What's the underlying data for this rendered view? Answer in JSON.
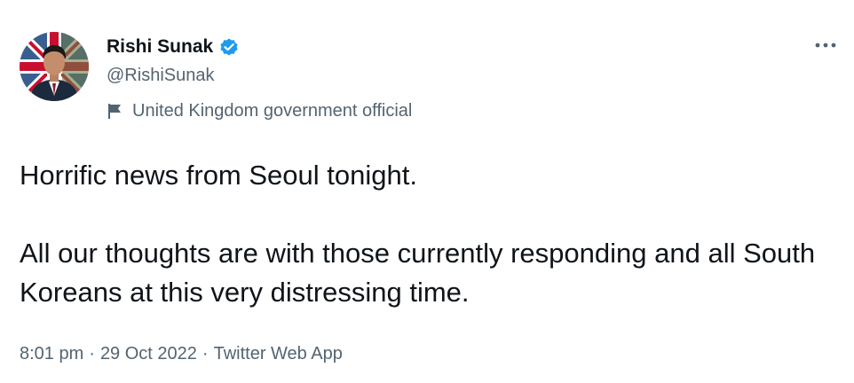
{
  "author": {
    "display_name": "Rishi Sunak",
    "handle": "@RishiSunak",
    "verified": true,
    "label": "United Kingdom government official"
  },
  "tweet": {
    "paragraphs": [
      "Horrific news from Seoul tonight.",
      "All our thoughts are with those currently responding and all South Koreans at this very distressing time."
    ]
  },
  "meta": {
    "time": "8:01 pm",
    "separator": "·",
    "date": "29 Oct 2022",
    "source": "Twitter Web App"
  },
  "icons": {
    "verified": "verified-badge-icon",
    "label": "flag-icon",
    "more": "more-options-icon"
  },
  "colors": {
    "verified_blue": "#1d9bf0",
    "text_primary": "#0f1419",
    "text_secondary": "#536471"
  }
}
